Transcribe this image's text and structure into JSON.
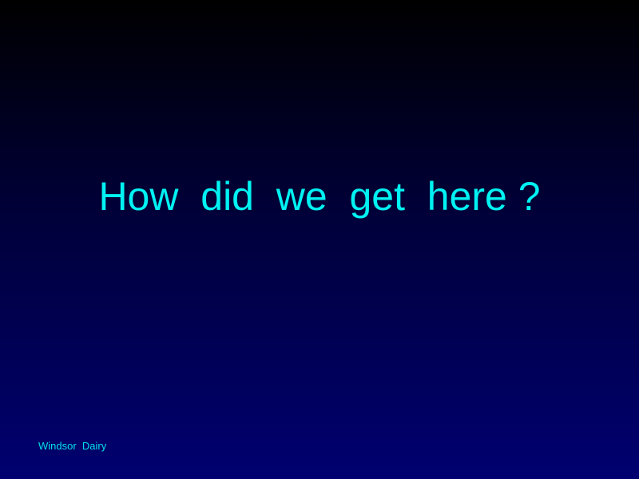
{
  "slide": {
    "title": "How  did  we  get  here ?",
    "footer": "Windsor  Dairy"
  },
  "colors": {
    "text": "#00f2f2",
    "background_top": "#000000",
    "background_bottom": "#000070"
  }
}
